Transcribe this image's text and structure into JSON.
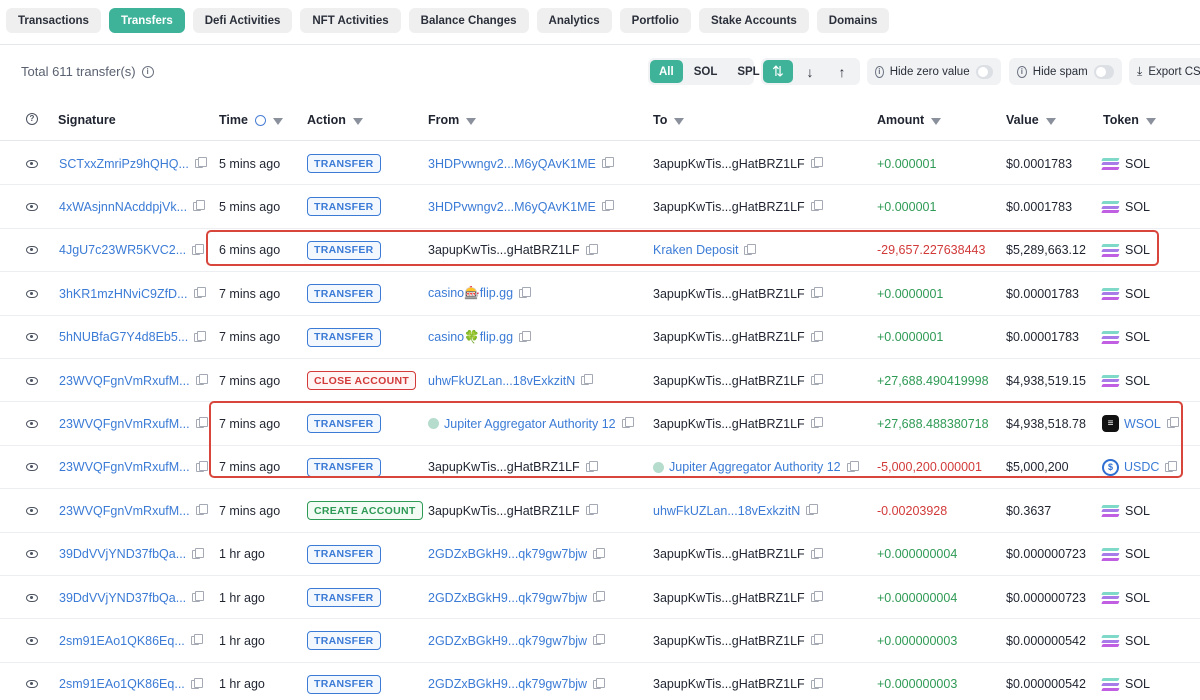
{
  "tabs": [
    "Transactions",
    "Transfers",
    "Defi Activities",
    "NFT Activities",
    "Balance Changes",
    "Analytics",
    "Portfolio",
    "Stake Accounts",
    "Domains"
  ],
  "active_tab": "Transfers",
  "toolbar": {
    "total": "Total 611 transfer(s)",
    "filters": [
      "All",
      "SOL",
      "SPL"
    ],
    "active_filter": "All",
    "direction_icons": [
      "both-arrows-icon",
      "arrow-down-icon",
      "arrow-up-icon"
    ],
    "hide_zero": "Hide zero value",
    "hide_spam": "Hide spam",
    "export": "Export CS"
  },
  "columns": {
    "signature": "Signature",
    "time": "Time",
    "action": "Action",
    "from": "From",
    "to": "To",
    "amount": "Amount",
    "value": "Value",
    "token": "Token"
  },
  "rows": [
    {
      "sig": "SCTxxZmriPz9hQHQ...",
      "time": "5 mins ago",
      "action": "TRANSFER",
      "from": "3HDPvwngv2...M6yQAvK1ME",
      "to": "3apupKwTis...gHatBRZ1LF",
      "amount": "+0.000001",
      "value": "$0.0001783",
      "token": "SOL"
    },
    {
      "sig": "4xWAsjnnNAcddpjVk...",
      "time": "5 mins ago",
      "action": "TRANSFER",
      "from": "3HDPvwngv2...M6yQAvK1ME",
      "to": "3apupKwTis...gHatBRZ1LF",
      "amount": "+0.000001",
      "value": "$0.0001783",
      "token": "SOL"
    },
    {
      "sig": "4JgU7c23WR5KVC2...",
      "time": "6 mins ago",
      "action": "TRANSFER",
      "from": "3apupKwTis...gHatBRZ1LF",
      "to": "Kraken Deposit",
      "amount": "-29,657.227638443",
      "value": "$5,289,663.12",
      "token": "SOL"
    },
    {
      "sig": "3hKR1mzHNviC9ZfD...",
      "time": "7 mins ago",
      "action": "TRANSFER",
      "from": "casino🎰flip.gg",
      "to": "3apupKwTis...gHatBRZ1LF",
      "amount": "+0.0000001",
      "value": "$0.00001783",
      "token": "SOL"
    },
    {
      "sig": "5hNUBfaG7Y4d8Eb5...",
      "time": "7 mins ago",
      "action": "TRANSFER",
      "from": "casino🍀flip.gg",
      "to": "3apupKwTis...gHatBRZ1LF",
      "amount": "+0.0000001",
      "value": "$0.00001783",
      "token": "SOL"
    },
    {
      "sig": "23WVQFgnVmRxufM...",
      "time": "7 mins ago",
      "action": "CLOSE ACCOUNT",
      "from": "uhwFkUZLan...18vExkzitN",
      "to": "3apupKwTis...gHatBRZ1LF",
      "amount": "+27,688.490419998",
      "value": "$4,938,519.15",
      "token": "SOL"
    },
    {
      "sig": "23WVQFgnVmRxufM...",
      "time": "7 mins ago",
      "action": "TRANSFER",
      "from": "Jupiter Aggregator Authority 12",
      "to": "3apupKwTis...gHatBRZ1LF",
      "amount": "+27,688.488380718",
      "value": "$4,938,518.78",
      "token": "WSOL"
    },
    {
      "sig": "23WVQFgnVmRxufM...",
      "time": "7 mins ago",
      "action": "TRANSFER",
      "from": "3apupKwTis...gHatBRZ1LF",
      "to": "Jupiter Aggregator Authority 12",
      "amount": "-5,000,200.000001",
      "value": "$5,000,200",
      "token": "USDC"
    },
    {
      "sig": "23WVQFgnVmRxufM...",
      "time": "7 mins ago",
      "action": "CREATE ACCOUNT",
      "from": "3apupKwTis...gHatBRZ1LF",
      "to": "uhwFkUZLan...18vExkzitN",
      "amount": "-0.00203928",
      "value": "$0.3637",
      "token": "SOL"
    },
    {
      "sig": "39DdVVjYND37fbQa...",
      "time": "1 hr ago",
      "action": "TRANSFER",
      "from": "2GDZxBGkH9...qk79gw7bjw",
      "to": "3apupKwTis...gHatBRZ1LF",
      "amount": "+0.000000004",
      "value": "$0.000000723",
      "token": "SOL"
    },
    {
      "sig": "39DdVVjYND37fbQa...",
      "time": "1 hr ago",
      "action": "TRANSFER",
      "from": "2GDZxBGkH9...qk79gw7bjw",
      "to": "3apupKwTis...gHatBRZ1LF",
      "amount": "+0.000000004",
      "value": "$0.000000723",
      "token": "SOL"
    },
    {
      "sig": "2sm91EAo1QK86Eq...",
      "time": "1 hr ago",
      "action": "TRANSFER",
      "from": "2GDZxBGkH9...qk79gw7bjw",
      "to": "3apupKwTis...gHatBRZ1LF",
      "amount": "+0.000000003",
      "value": "$0.000000542",
      "token": "SOL"
    },
    {
      "sig": "2sm91EAo1QK86Eq...",
      "time": "1 hr ago",
      "action": "TRANSFER",
      "from": "2GDZxBGkH9...qk79gw7bjw",
      "to": "3apupKwTis...gHatBRZ1LF",
      "amount": "+0.000000003",
      "value": "$0.000000542",
      "token": "SOL"
    }
  ],
  "colors": {
    "accent": "#3fb39a",
    "link": "#3b7bd6",
    "positive": "#2e9a55",
    "negative": "#d23a3a",
    "highlight": "#d8453a"
  }
}
